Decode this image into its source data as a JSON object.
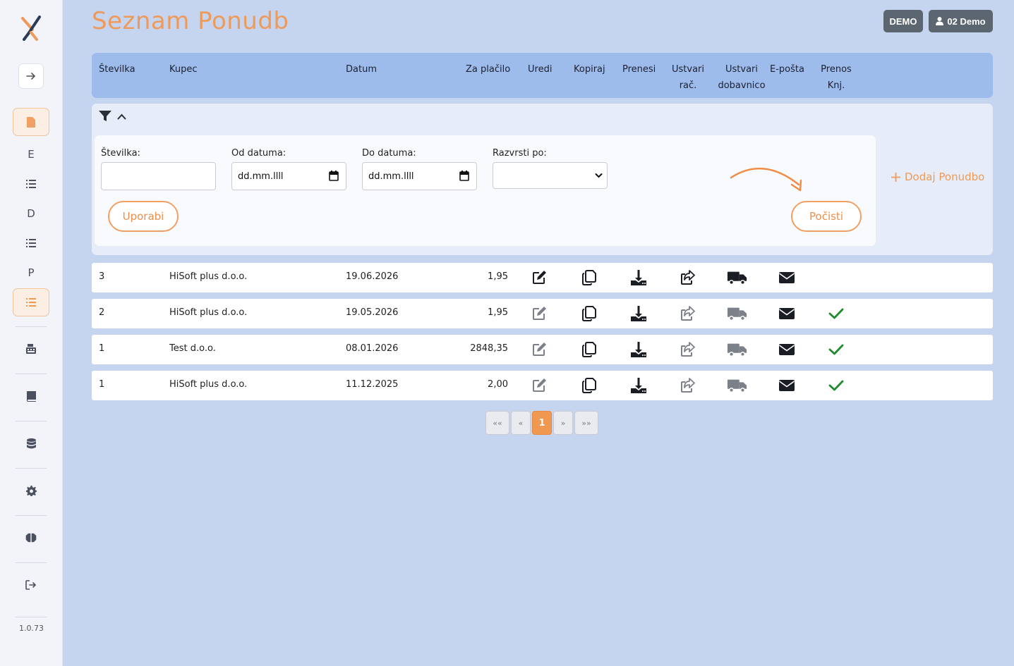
{
  "app": {
    "title": "Seznam Ponudb",
    "version": "1.0.73"
  },
  "top_bar": {
    "demo_label": "DEMO",
    "user_label": "02 Demo"
  },
  "sidebar": {
    "items": [
      {
        "label": "",
        "icon": "document-icon",
        "active": true
      },
      {
        "label": "E",
        "icon": "letter-e"
      },
      {
        "label": "",
        "icon": "list-icon"
      },
      {
        "label": "D",
        "icon": "letter-d"
      },
      {
        "label": "",
        "icon": "list-icon"
      },
      {
        "label": "P",
        "icon": "letter-p"
      },
      {
        "label": "",
        "icon": "list-icon",
        "active": true
      }
    ]
  },
  "table": {
    "headers": {
      "stevilka": "Številka",
      "kupec": "Kupec",
      "datum": "Datum",
      "za_placilo": "Za plačilo",
      "uredi": "Uredi",
      "kopiraj": "Kopiraj",
      "prenesi": "Prenesi",
      "ustvari_rac_1": "Ustvari",
      "ustvari_rac_2": "rač.",
      "ustvari_dob_1": "Ustvari",
      "ustvari_dob_2": "dobavnico",
      "eposta": "E-pošta",
      "prenos_1": "Prenos",
      "prenos_2": "Knj."
    },
    "rows": [
      {
        "stevilka": "3",
        "kupec": "HiSoft plus d.o.o.",
        "datum": "19.06.2026",
        "za_placilo": "1,95",
        "prenos": false
      },
      {
        "stevilka": "2",
        "kupec": "HiSoft plus d.o.o.",
        "datum": "19.05.2026",
        "za_placilo": "1,95",
        "prenos": true
      },
      {
        "stevilka": "1",
        "kupec": "Test d.o.o.",
        "datum": "08.01.2026",
        "za_placilo": "2848,35",
        "prenos": true
      },
      {
        "stevilka": "1",
        "kupec": "HiSoft plus d.o.o.",
        "datum": "11.12.2025",
        "za_placilo": "2,00",
        "prenos": true
      }
    ]
  },
  "filter": {
    "stevilka_label": "Številka:",
    "stevilka_value": "",
    "od_label": "Od datuma:",
    "od_value": "dd.mm.llll",
    "do_label": "Do datuma:",
    "do_value": "dd.mm.llll",
    "razvrsti_label": "Razvrsti po:",
    "razvrsti_value": "",
    "apply_label": "Uporabi",
    "clear_label": "Počisti",
    "add_label": "Dodaj Ponudbo"
  },
  "pagination": {
    "first": "««",
    "prev": "«",
    "current": "1",
    "next": "»",
    "last": "»»"
  },
  "colors": {
    "accent": "#ee9a5a",
    "header_bg": "#9dbcec",
    "check": "#1f8a2e"
  }
}
